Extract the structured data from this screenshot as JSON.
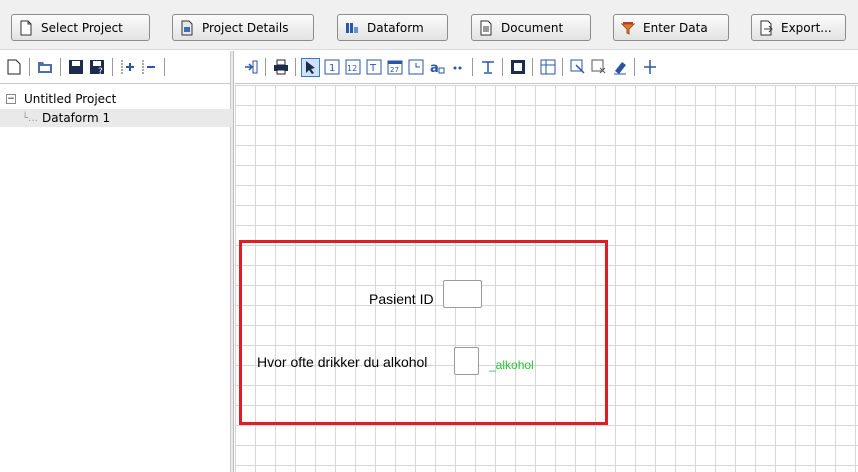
{
  "toolbar": {
    "select_project": "Select Project",
    "project_details": "Project Details",
    "dataform": "Dataform",
    "document": "Document",
    "enter_data": "Enter Data",
    "export": "Export..."
  },
  "tree": {
    "project": "Untitled Project",
    "expander": "−",
    "dataform": "Dataform 1"
  },
  "form": {
    "field1_label": "Pasient ID",
    "field1_value": "",
    "field2_label": "Hvor ofte drikker du alkohol",
    "field2_value": "",
    "field2_varname": "_alkohol"
  },
  "colors": {
    "highlight": "#e31b23",
    "varname": "#22c532"
  }
}
